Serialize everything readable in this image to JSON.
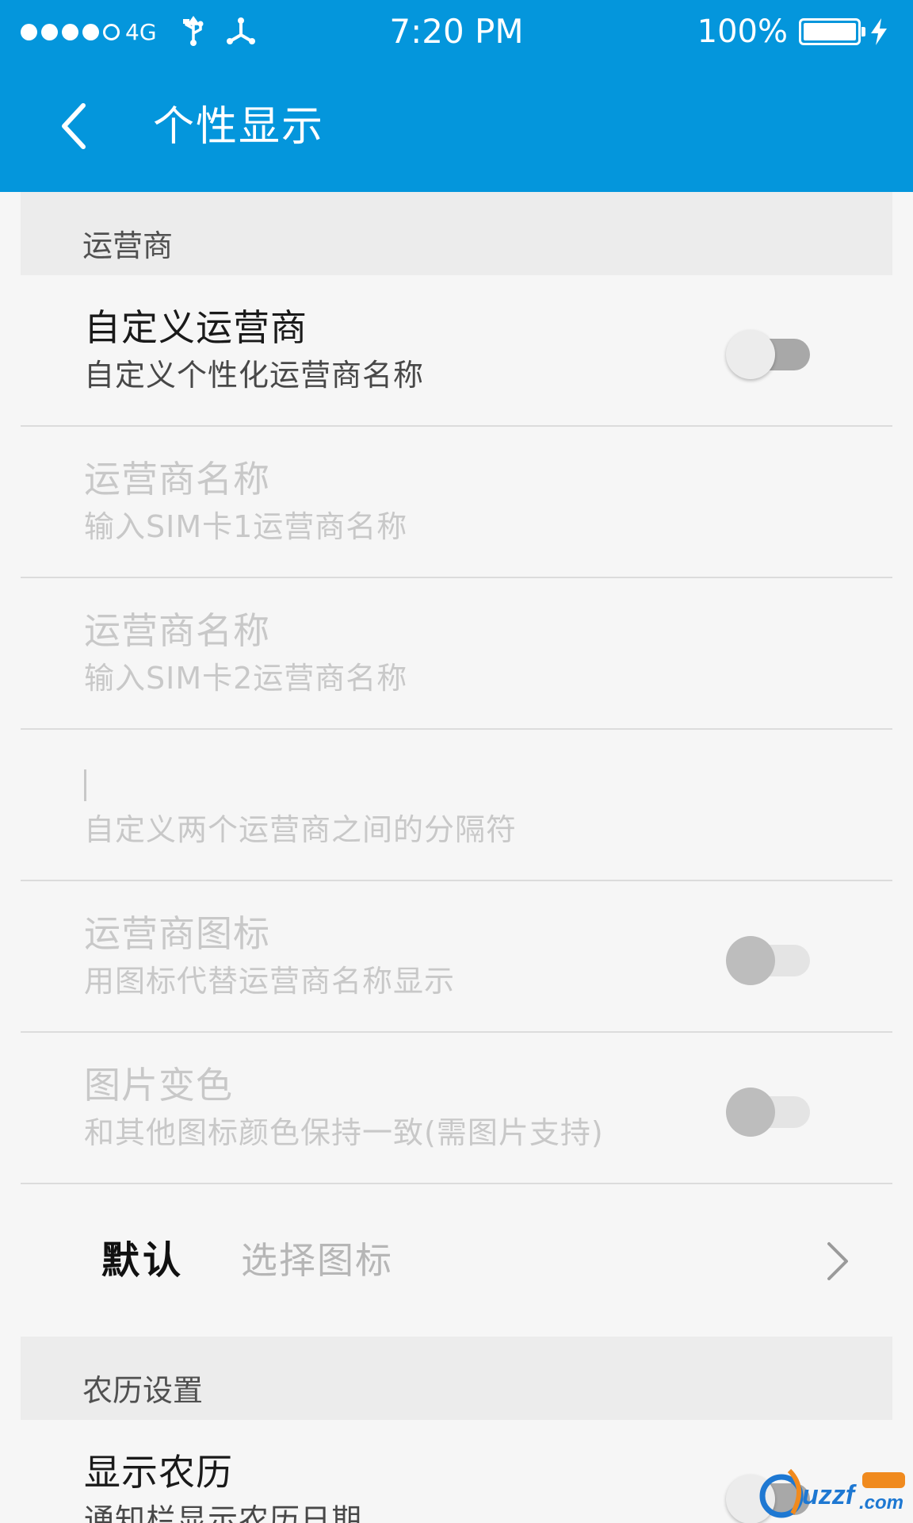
{
  "status_bar": {
    "network": "4G",
    "time": "7:20 PM",
    "battery_percent": "100%",
    "battery_level": 1.0,
    "signal_bars_filled": 4,
    "signal_bars_total": 5
  },
  "app_bar": {
    "title": "个性显示",
    "back_icon": "chevron-left-icon"
  },
  "sections": {
    "carrier": {
      "header": "运营商",
      "custom_carrier": {
        "title": "自定义运营商",
        "subtitle": "自定义个性化运营商名称",
        "toggle_on": false
      },
      "sim1_name": {
        "title": "运营商名称",
        "subtitle": "输入SIM卡1运营商名称"
      },
      "sim2_name": {
        "title": "运营商名称",
        "subtitle": "输入SIM卡2运营商名称"
      },
      "separator": {
        "value": "|",
        "subtitle": "自定义两个运营商之间的分隔符"
      },
      "carrier_icon": {
        "title": "运营商图标",
        "subtitle": "用图标代替运营商名称显示",
        "toggle_on": false
      },
      "image_tint": {
        "title": "图片变色",
        "subtitle": "和其他图标颜色保持一致(需图片支持)",
        "toggle_on": false
      },
      "icon_select": {
        "label": "默认",
        "value": "选择图标"
      }
    },
    "lunar": {
      "header": "农历设置",
      "show_lunar": {
        "title": "显示农历",
        "subtitle": "通知栏显示农历日期",
        "toggle_on": false
      }
    }
  },
  "colors": {
    "accent": "#0496dc",
    "background": "#f6f6f6",
    "section_header_bg": "#ececec",
    "disabled_text": "#c8c8c8"
  }
}
